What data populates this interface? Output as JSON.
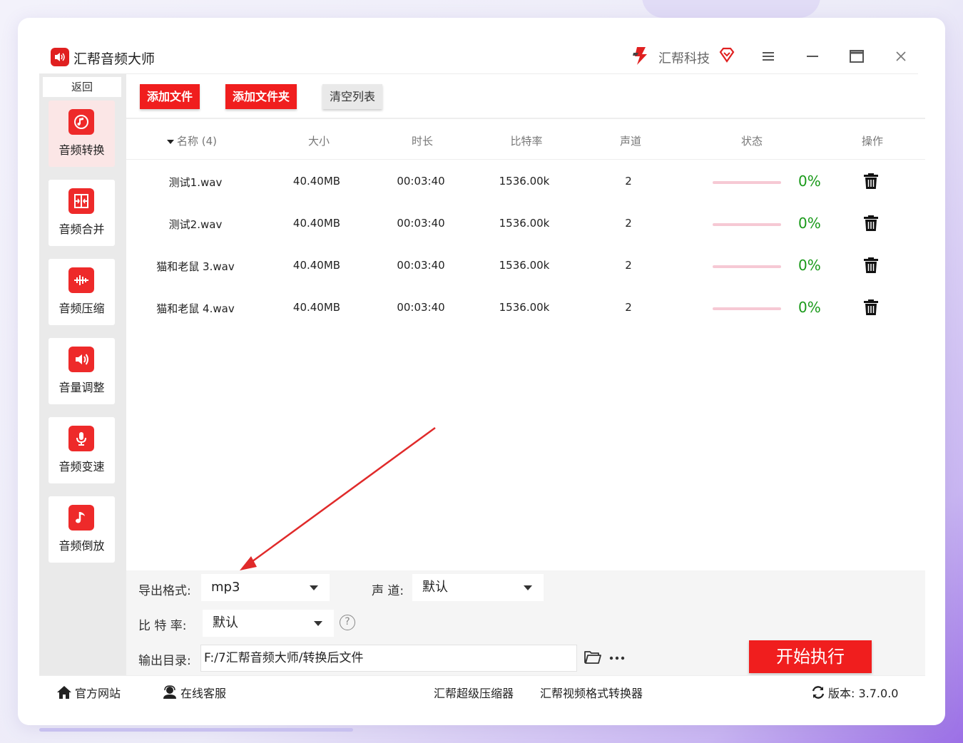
{
  "app": {
    "title": "汇帮音频大师",
    "brand": "汇帮科技"
  },
  "colors": {
    "accent": "#f01e1e",
    "success": "#1a9a1a",
    "sidebar_bg": "#eaeaea"
  },
  "sidebar": {
    "back_label": "返回",
    "items": [
      {
        "label": "音频转换",
        "icon": "audio-convert-icon",
        "active": true
      },
      {
        "label": "音频合并",
        "icon": "audio-merge-icon",
        "active": false
      },
      {
        "label": "音频压缩",
        "icon": "audio-compress-icon",
        "active": false
      },
      {
        "label": "音量调整",
        "icon": "volume-adjust-icon",
        "active": false
      },
      {
        "label": "音频变速",
        "icon": "audio-speed-icon",
        "active": false
      },
      {
        "label": "音频倒放",
        "icon": "audio-reverse-icon",
        "active": false
      }
    ]
  },
  "toolbar": {
    "add_file": "添加文件",
    "add_folder": "添加文件夹",
    "clear_list": "清空列表"
  },
  "table": {
    "headers": {
      "name": "名称 (4)",
      "size": "大小",
      "duration": "时长",
      "bitrate": "比特率",
      "channels": "声道",
      "status": "状态",
      "action": "操作"
    },
    "rows": [
      {
        "name": "测试1.wav",
        "size": "40.40MB",
        "duration": "00:03:40",
        "bitrate": "1536.00k",
        "channels": "2",
        "progress": 0,
        "status": "0%"
      },
      {
        "name": "测试2.wav",
        "size": "40.40MB",
        "duration": "00:03:40",
        "bitrate": "1536.00k",
        "channels": "2",
        "progress": 0,
        "status": "0%"
      },
      {
        "name": "猫和老鼠 3.wav",
        "size": "40.40MB",
        "duration": "00:03:40",
        "bitrate": "1536.00k",
        "channels": "2",
        "progress": 0,
        "status": "0%"
      },
      {
        "name": "猫和老鼠 4.wav",
        "size": "40.40MB",
        "duration": "00:03:40",
        "bitrate": "1536.00k",
        "channels": "2",
        "progress": 0,
        "status": "0%"
      }
    ]
  },
  "settings": {
    "format_label": "导出格式:",
    "format_value": "mp3",
    "channel_label": "声 道:",
    "channel_value": "默认",
    "bitrate_label": "比 特 率:",
    "bitrate_value": "默认",
    "output_label": "输出目录:",
    "output_path": "F:/7汇帮音频大师/转换后文件",
    "start_label": "开始执行"
  },
  "footer": {
    "website": "官方网站",
    "support": "在线客服",
    "compressor": "汇帮超级压缩器",
    "video_converter": "汇帮视频格式转换器",
    "version": "版本: 3.7.0.0"
  }
}
